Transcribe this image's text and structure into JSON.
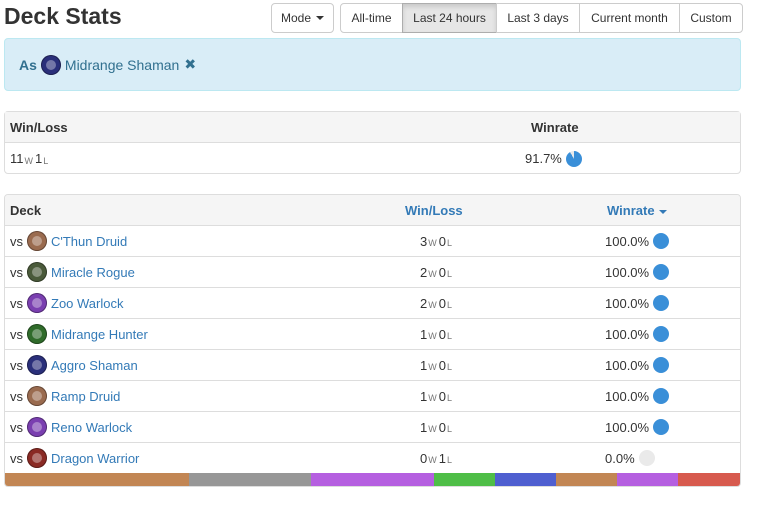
{
  "header": {
    "title": "Deck Stats",
    "mode_label": "Mode",
    "range_options": [
      "All-time",
      "Last 24 hours",
      "Last 3 days",
      "Current month",
      "Custom"
    ],
    "active_range": "Last 24 hours"
  },
  "filter": {
    "prefix": "As",
    "deck": "Midrange Shaman",
    "deck_icon": "shaman-class-icon",
    "remove_icon": "close-icon"
  },
  "summary": {
    "col_winloss": "Win/Loss",
    "col_winrate": "Winrate",
    "wins": "11",
    "losses": "1",
    "win_suffix": "W",
    "loss_suffix": "L",
    "winrate": "91.7%",
    "winrate_fraction": 0.917
  },
  "decks": {
    "col_deck": "Deck",
    "col_winloss": "Win/Loss",
    "col_winrate": "Winrate",
    "vs_label": "vs",
    "rows": [
      {
        "name": "C'Thun Druid",
        "icon": "druid-class-icon",
        "color": "#9a6b4f",
        "wins": "3",
        "losses": "0",
        "winrate": "100.0%",
        "fraction": 1.0
      },
      {
        "name": "Miracle Rogue",
        "icon": "rogue-class-icon",
        "color": "#4a5a3a",
        "wins": "2",
        "losses": "0",
        "winrate": "100.0%",
        "fraction": 1.0
      },
      {
        "name": "Zoo Warlock",
        "icon": "warlock-class-icon",
        "color": "#7a3fb0",
        "wins": "2",
        "losses": "0",
        "winrate": "100.0%",
        "fraction": 1.0
      },
      {
        "name": "Midrange Hunter",
        "icon": "hunter-class-icon",
        "color": "#2f6b2a",
        "wins": "1",
        "losses": "0",
        "winrate": "100.0%",
        "fraction": 1.0
      },
      {
        "name": "Aggro Shaman",
        "icon": "shaman-class-icon",
        "color": "#2a2f7a",
        "wins": "1",
        "losses": "0",
        "winrate": "100.0%",
        "fraction": 1.0
      },
      {
        "name": "Ramp Druid",
        "icon": "druid-class-icon",
        "color": "#9a6b4f",
        "wins": "1",
        "losses": "0",
        "winrate": "100.0%",
        "fraction": 1.0
      },
      {
        "name": "Reno Warlock",
        "icon": "warlock-class-icon",
        "color": "#7a3fb0",
        "wins": "1",
        "losses": "0",
        "winrate": "100.0%",
        "fraction": 1.0
      },
      {
        "name": "Dragon Warrior",
        "icon": "warrior-class-icon",
        "color": "#8a2a24",
        "wins": "0",
        "losses": "1",
        "winrate": "0.0%",
        "fraction": 0.0
      }
    ]
  },
  "class_distribution": [
    {
      "class": "druid",
      "color": "#c28654",
      "fraction": 0.25
    },
    {
      "class": "neutral",
      "color": "#979797",
      "fraction": 0.167
    },
    {
      "class": "warlock",
      "color": "#b55fe0",
      "fraction": 0.167
    },
    {
      "class": "hunter",
      "color": "#4fbe47",
      "fraction": 0.083
    },
    {
      "class": "shaman",
      "color": "#4f5fd0",
      "fraction": 0.083
    },
    {
      "class": "druid",
      "color": "#c28654",
      "fraction": 0.083
    },
    {
      "class": "warlock",
      "color": "#b55fe0",
      "fraction": 0.083
    },
    {
      "class": "warrior",
      "color": "#d75a4e",
      "fraction": 0.084
    }
  ],
  "colors": {
    "link": "#337ab7",
    "info_bg": "#d9edf7",
    "pie_fill": "#3a8fd8",
    "pie_empty": "#eaeaea"
  }
}
